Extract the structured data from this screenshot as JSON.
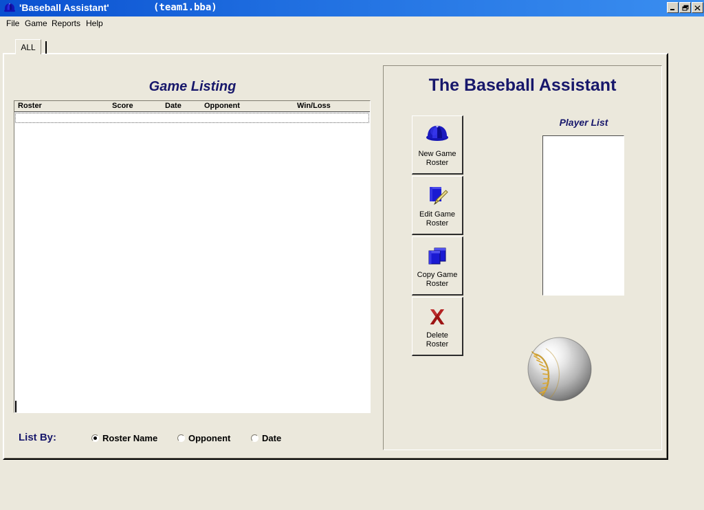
{
  "window": {
    "title": "'Baseball Assistant'",
    "filename": "(team1.bba)",
    "icon": "baseball-cap-icon",
    "controls": {
      "minimize": "–",
      "maximize": "❐",
      "close": "✕"
    },
    "accent_color": "#17176b",
    "titlebar_gradient_from": "#0a50d0",
    "titlebar_gradient_to": "#3a8ef0",
    "face_color": "#ebe8dc"
  },
  "menubar": {
    "items": [
      {
        "label": "File"
      },
      {
        "label": "Game"
      },
      {
        "label": "Reports"
      },
      {
        "label": "Help"
      }
    ]
  },
  "tabs": [
    {
      "label": "ALL",
      "selected": true
    }
  ],
  "game_listing": {
    "title": "Game Listing",
    "columns": [
      {
        "label": "Roster"
      },
      {
        "label": "Score"
      },
      {
        "label": "Date"
      },
      {
        "label": "Opponent"
      },
      {
        "label": "Win/Loss"
      }
    ],
    "rows": []
  },
  "list_by": {
    "label": "List By:",
    "options": [
      {
        "label": "Roster Name",
        "selected": true
      },
      {
        "label": "Opponent",
        "selected": false
      },
      {
        "label": "Date",
        "selected": false
      }
    ]
  },
  "right_panel": {
    "heading": "The Baseball Assistant",
    "player_list": {
      "title": "Player List",
      "items": []
    },
    "buttons": [
      {
        "label": "New Game\nRoster",
        "icon": "baseball-cap-icon"
      },
      {
        "label": "Edit Game\nRoster",
        "icon": "page-pencil-icon"
      },
      {
        "label": "Copy Game\nRoster",
        "icon": "copy-pages-icon"
      },
      {
        "label": "Delete\nRoster",
        "icon": "red-x-icon"
      }
    ],
    "decoration": {
      "icon": "baseball-image"
    }
  }
}
